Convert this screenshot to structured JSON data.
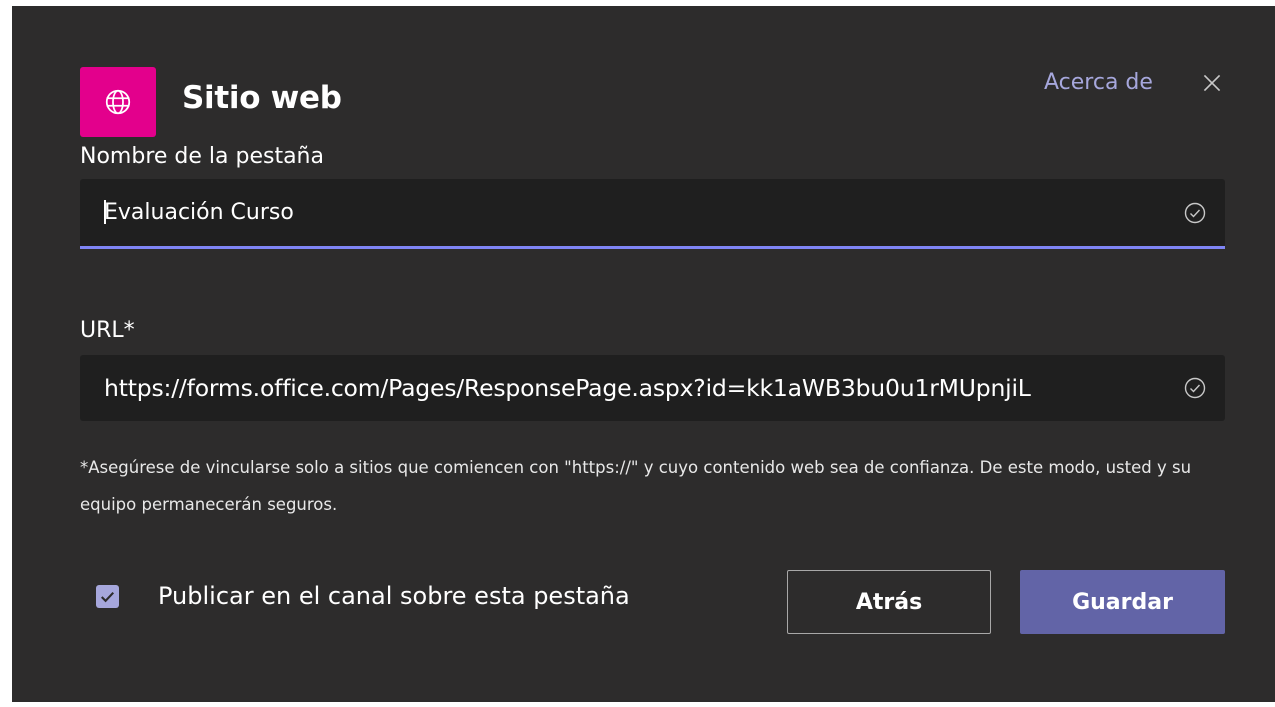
{
  "dialog": {
    "app_title": "Sitio web",
    "app_icon": "globe-icon",
    "app_color": "#e3008c",
    "about_label": "Acerca de",
    "close_icon": "close-icon"
  },
  "tab_name": {
    "label": "Nombre de la pestaña",
    "value": "Evaluación Curso",
    "status_icon": "check-circle-icon"
  },
  "url": {
    "label": "URL*",
    "value": "https://forms.office.com/Pages/ResponsePage.aspx?id=kk1aWB3bu0u1rMUpnjiL",
    "status_icon": "check-circle-icon"
  },
  "note": "*Asegúrese de vincularse solo a sitios que comiencen con \"https://\" y cuyo contenido web sea de confianza. De este modo, usted y su equipo permanecerán seguros.",
  "post_option": {
    "label": "Publicar en el canal sobre esta pestaña",
    "checked": true
  },
  "buttons": {
    "back": "Atrás",
    "save": "Guardar"
  },
  "colors": {
    "dialog_background": "#2d2c2c",
    "input_background": "#1f1f1f",
    "accent": "#6264a7",
    "link": "#a6a7dc",
    "focus_underline": "#7f85f5"
  }
}
